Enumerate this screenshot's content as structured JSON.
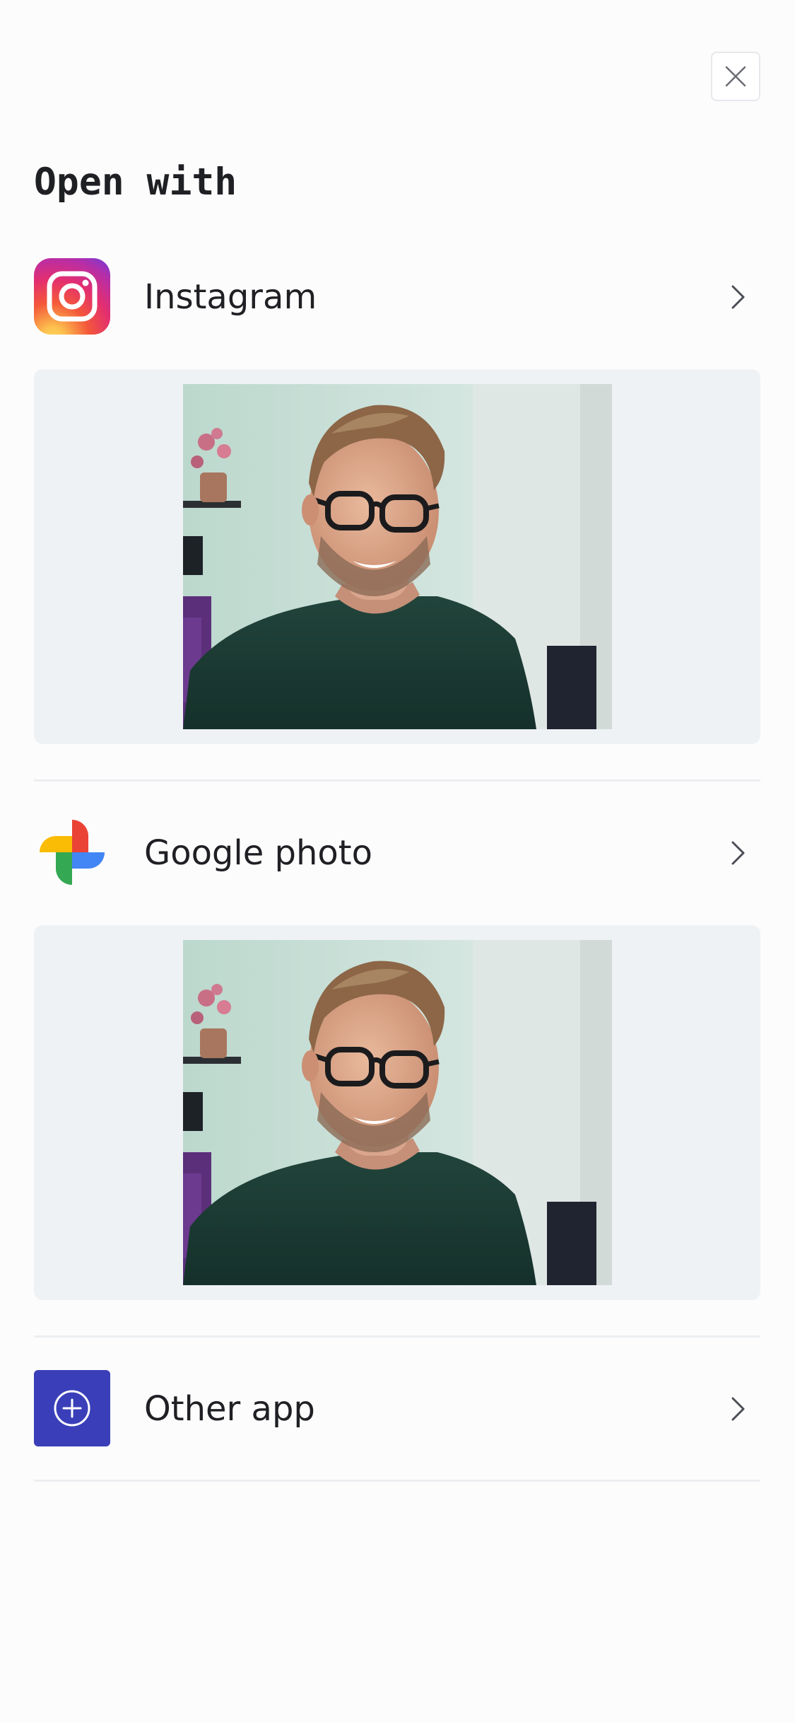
{
  "sheet": {
    "close_icon": "close-icon",
    "title": "Open with"
  },
  "apps": [
    {
      "label": "Instagram",
      "icon": "instagram-icon",
      "chevron_icon": "chevron-right-icon",
      "preview": "portrait of smiling man with glasses"
    },
    {
      "label": "Google photo",
      "icon": "google-photos-icon",
      "chevron_icon": "chevron-right-icon",
      "preview": "portrait of smiling man with glasses"
    },
    {
      "label": "Other app",
      "icon": "plus-circle-icon",
      "chevron_icon": "chevron-right-icon"
    }
  ],
  "colors": {
    "background": "#fdfcfc",
    "text": "#1f2024",
    "card_background": "#eff2f5",
    "divider": "#eceef1",
    "other_app_accent": "#3a3fb9"
  }
}
